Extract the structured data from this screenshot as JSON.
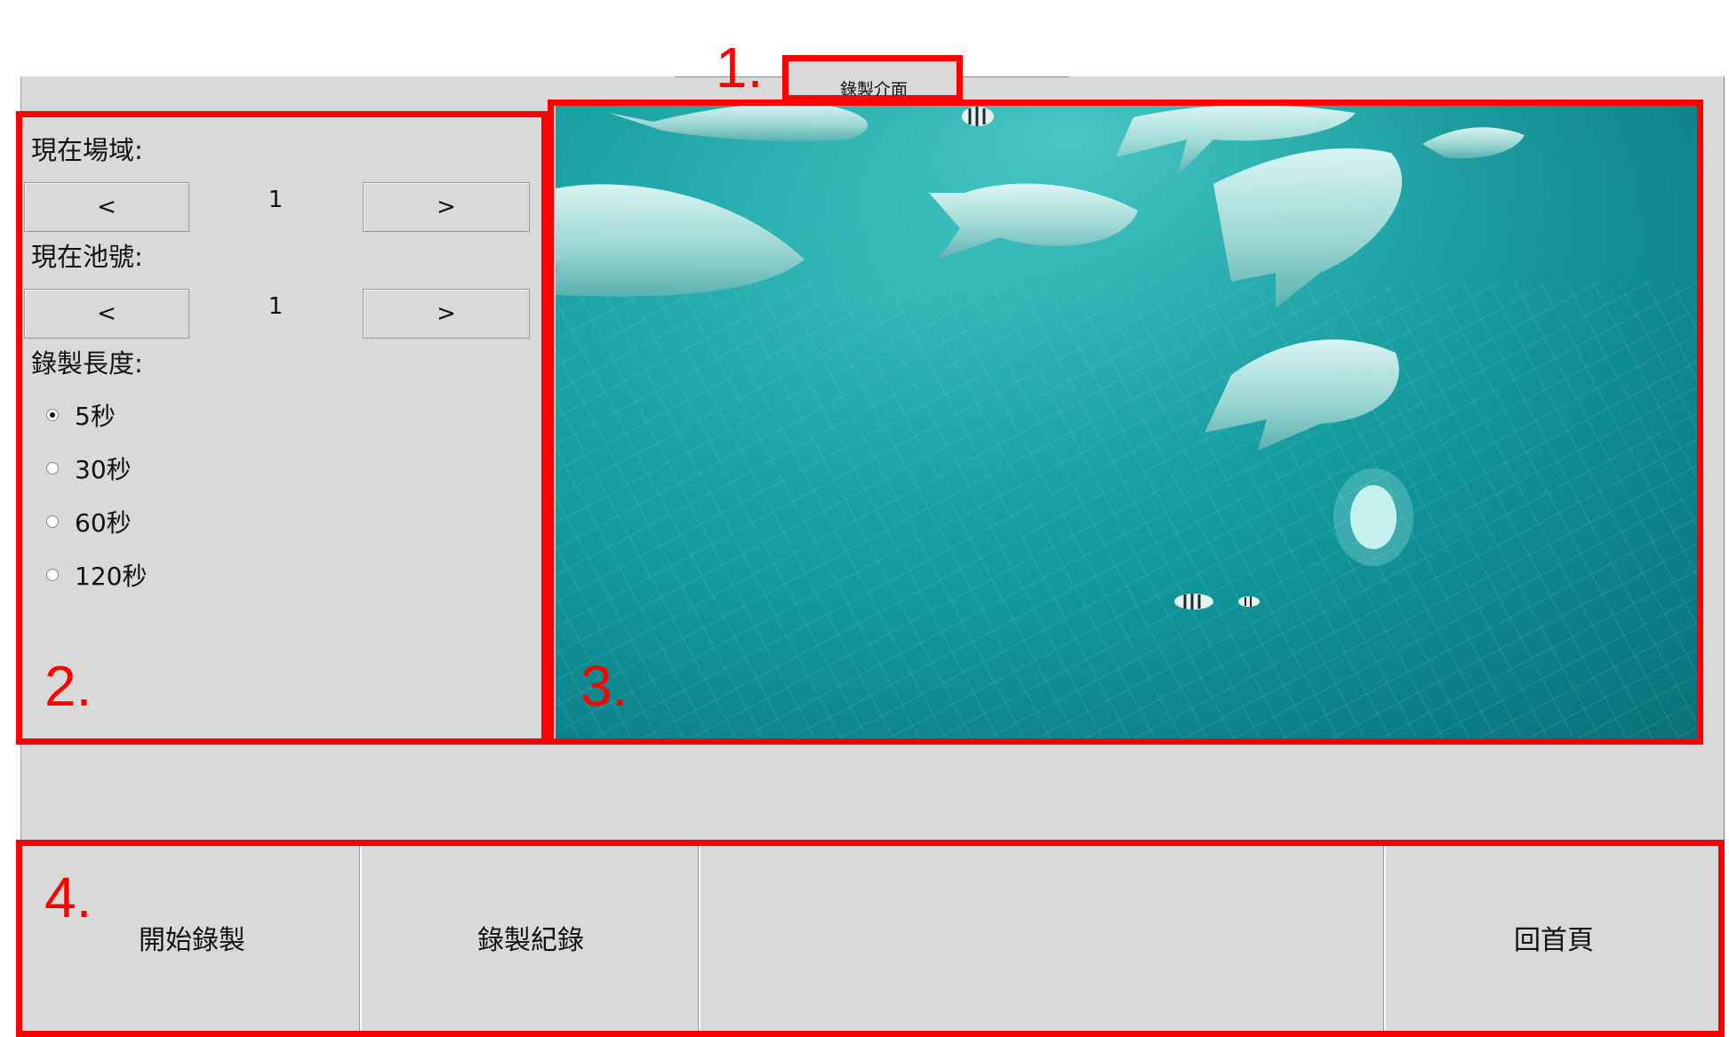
{
  "tab": {
    "title": "錄製介面"
  },
  "left_panel": {
    "field_label": "現在場域:",
    "field_value": "1",
    "pool_label": "現在池號:",
    "pool_value": "1",
    "prev_label": "<",
    "next_label": ">",
    "length_label": "錄製長度:",
    "length_options": [
      {
        "label": "5秒",
        "selected": true
      },
      {
        "label": "30秒",
        "selected": false
      },
      {
        "label": "60秒",
        "selected": false
      },
      {
        "label": "120秒",
        "selected": false
      }
    ]
  },
  "bottom_bar": {
    "start_label": "開始錄製",
    "records_label": "錄製紀錄",
    "home_label": "回首頁"
  },
  "annotations": {
    "n1": "1.",
    "n2": "2.",
    "n3": "3.",
    "n4": "4.",
    "color": "#ff0000"
  }
}
